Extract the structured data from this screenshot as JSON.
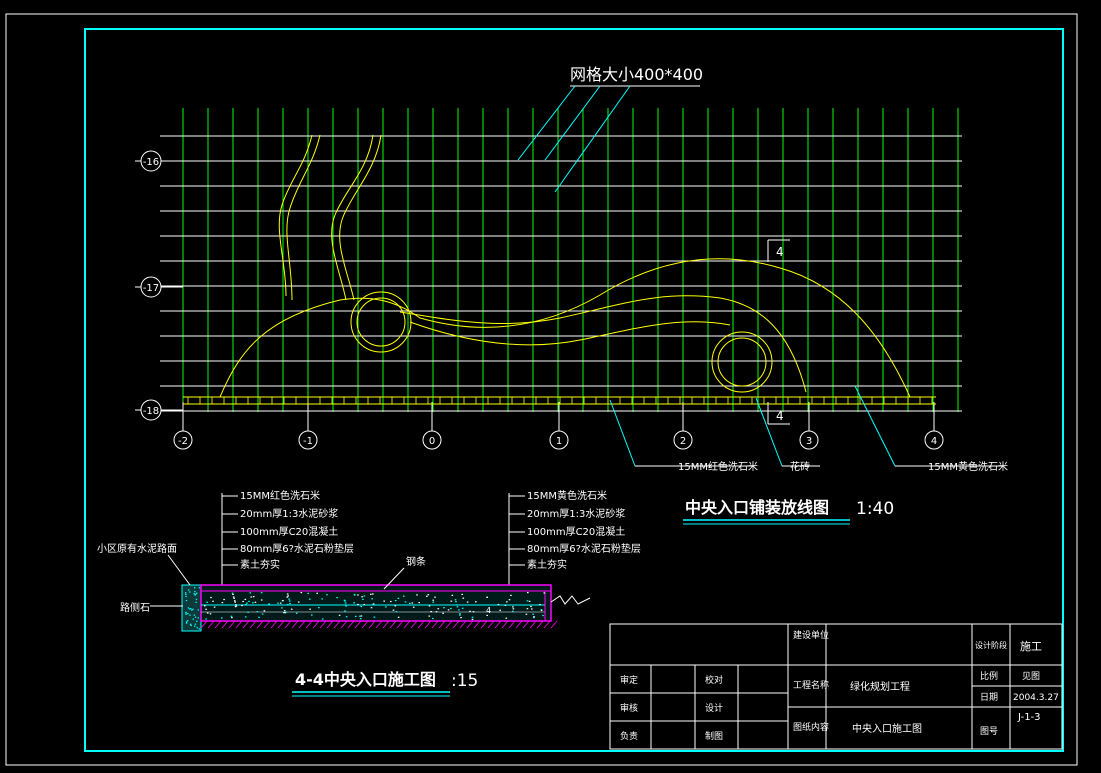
{
  "grid_note": "网格大小400*400",
  "row_labels": [
    "-16",
    "-17",
    "-18"
  ],
  "column_labels": [
    "-2",
    "-1",
    "0",
    "1",
    "2",
    "3",
    "4"
  ],
  "section_mark": "4",
  "plan_callouts": {
    "red_stone": "15MM红色洗石米",
    "edge": "花砖",
    "yellow_stone": "15MM黄色洗石米"
  },
  "plan_title": "中央入口铺装放线图",
  "plan_scale": "1:40",
  "section_layers_left": [
    "15MM红色洗石米",
    "20mm厚1:3水泥砂浆",
    "100mm厚C20混凝土",
    "80mm厚6?水泥石粉垫层",
    "素土夯实"
  ],
  "section_layers_right": [
    "15MM黄色洗石米",
    "20mm厚1:3水泥砂浆",
    "100mm厚C20混凝土",
    "80mm厚6?水泥石粉垫层",
    "素土夯实"
  ],
  "section_labels": {
    "road": "小区原有水泥路面",
    "curb": "路侧石",
    "rebar": "钢条",
    "inner_mark": "4"
  },
  "section_title": "4-4中央入口施工图",
  "section_scale": ":15",
  "title_block": {
    "sign_labels": [
      "审定",
      "审核",
      "负责"
    ],
    "role_labels": [
      "校对",
      "设计",
      "制图"
    ],
    "unit_label": "建设单位",
    "project_label": "工程名称",
    "project_name": "绿化规划工程",
    "drawing_label": "图纸内容",
    "drawing_name": "中央入口施工图",
    "stage_label": "设计阶段",
    "stage_value": "施工",
    "scale_label": "比例",
    "scale_value": "见图",
    "date_label": "日期",
    "date_value": "2004.3.27",
    "sheet_label": "图号",
    "sheet_value": "J-1-3"
  },
  "colors": {
    "frame": "#00ffff",
    "grid_vertical": "#00ff00",
    "grid_horizontal": "#ffffff",
    "curve": "#ffff00",
    "section": "#ff00ff",
    "annotation": "#ffffff"
  }
}
